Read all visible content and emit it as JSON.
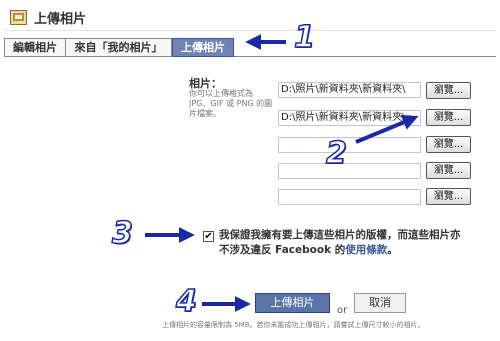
{
  "header": {
    "title": "上傳相片",
    "icon": "photo-album-icon"
  },
  "tabs": [
    {
      "label": "編輯相片",
      "active": false
    },
    {
      "label": "來自「我的相片」",
      "active": false
    },
    {
      "label": "上傳相片",
      "active": true
    }
  ],
  "form": {
    "photos_label": "相片：",
    "help_text": "你可以上傳格式為 JPG、GIF 或 PNG 的圖片檔案。",
    "files": [
      {
        "value": "D:\\照片\\新資料夾\\新資料夾\\",
        "browse_label": "瀏覽..."
      },
      {
        "value": "D:\\照片\\新資料夾\\新資料夾\\",
        "browse_label": "瀏覽..."
      },
      {
        "value": "",
        "browse_label": "瀏覽..."
      },
      {
        "value": "",
        "browse_label": "瀏覽..."
      },
      {
        "value": "",
        "browse_label": "瀏覽..."
      }
    ],
    "certify": {
      "checked": true,
      "text_1": "我保證我擁有要上傳這些相片的版權，而這些相片亦不涉及違反 Facebook 的",
      "link": "使用條款",
      "text_2": "。"
    },
    "upload_label": "上傳相片",
    "or_text": "or",
    "cancel_label": "取消",
    "footer_note": "上傳相片的容量限制為 5MB。若你未能成功上傳相片，請嘗試上傳尺寸較小的相片。"
  },
  "annotations": {
    "color": "#1a28a8",
    "steps": [
      "1",
      "2",
      "3",
      "4"
    ]
  }
}
